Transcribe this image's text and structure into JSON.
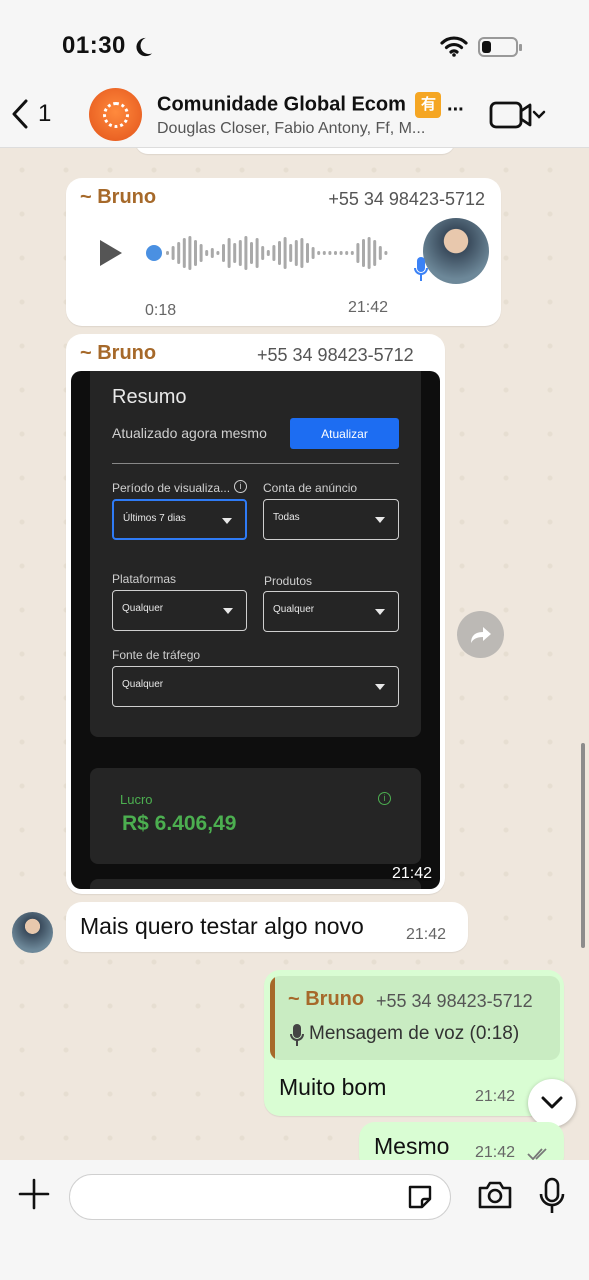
{
  "status_bar": {
    "time": "01:30",
    "battery_level": 0.25
  },
  "header": {
    "back_count": "1",
    "title": "Comunidade Global Ecom",
    "title_badge": "有",
    "title_ellipsis": "...",
    "subtitle": "Douglas Closer, Fabio Antony, Ff, M..."
  },
  "messages": {
    "voice": {
      "sender": "~ Bruno",
      "phone": "+55 34 98423-5712",
      "duration": "0:18",
      "time": "21:42"
    },
    "image": {
      "sender": "~ Bruno",
      "phone": "+55 34 98423-5712",
      "time": "21:42",
      "screenshot": {
        "title": "Resumo",
        "subtitle": "Atualizado agora mesmo",
        "update_button": "Atualizar",
        "period_label": "Período de visualiza...",
        "period_value": "Últimos 7 dias",
        "account_label": "Conta de anúncio",
        "account_value": "Todas",
        "platforms_label": "Plataformas",
        "platforms_value": "Qualquer",
        "products_label": "Produtos",
        "products_value": "Qualquer",
        "traffic_label": "Fonte de tráfego",
        "traffic_value": "Qualquer",
        "profit_label": "Lucro",
        "profit_value": "R$ 6.406,49",
        "info_glyph": "i"
      }
    },
    "text_in": {
      "text": "Mais quero testar algo novo",
      "time": "21:42"
    },
    "reply_out": {
      "quote_sender": "~ Bruno",
      "quote_phone": "+55 34 98423-5712",
      "quote_text": "Mensagem de voz (0:18)",
      "text": "Muito bom",
      "time": "21:42"
    },
    "text_out": {
      "text": "Mesmo",
      "time": "21:42"
    }
  },
  "input": {
    "placeholder": ""
  },
  "colors": {
    "sender": "#a6692a",
    "outgoing_bubble": "#d9fdd3",
    "incoming_bubble": "#ffffff",
    "accent_blue": "#1d6df2",
    "profit_green": "#4caf50"
  }
}
